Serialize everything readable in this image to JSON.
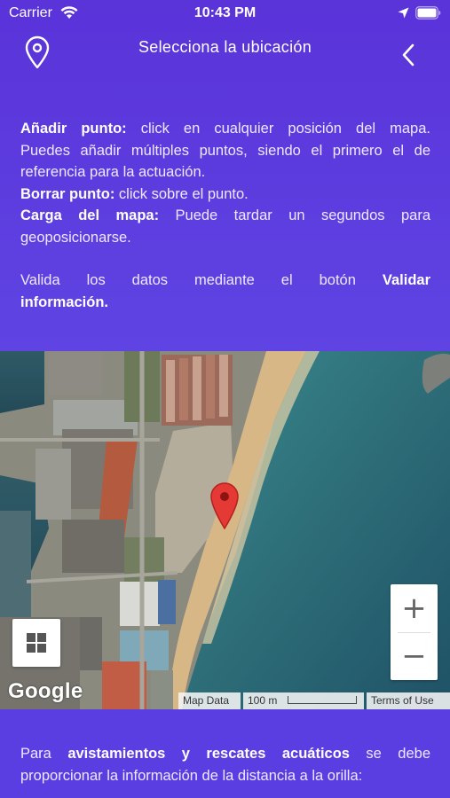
{
  "status_bar": {
    "carrier": "Carrier",
    "time": "10:43 PM",
    "icons": [
      "wifi-icon",
      "location-arrow-icon",
      "battery-icon"
    ]
  },
  "header": {
    "title": "Selecciona la ubicación",
    "left_icon": "map-pin-outline-icon",
    "right_icon": "chevron-left-icon"
  },
  "instructions": {
    "add_point_label": "Añadir punto:",
    "add_point_text_1": "click en cualquier posición del mapa.",
    "add_point_text_2": "Puedes añadir múltiples puntos, siendo el primero el de",
    "add_point_text_3": "referencia para la actuación.",
    "delete_point_label": "Borrar punto:",
    "delete_point_text": "click sobre el punto.",
    "map_load_label": "Carga del mapa:",
    "map_load_text_1": "Puede tardar un segundos para",
    "map_load_text_2": "geoposicionarse.",
    "validate_text": "Valida los datos mediante el botón",
    "validate_button_ref_1": "Validar",
    "validate_button_ref_2": "información.",
    "validate_line_words": [
      "Valida",
      "los",
      "datos",
      "mediante",
      "el",
      "botón"
    ]
  },
  "map": {
    "zoom_in_label": "+",
    "zoom_out_label": "−",
    "google_logo": "Google",
    "attribution_data": "Map Data",
    "scale_label": "100 m",
    "terms_label": "Terms of Use",
    "marker_color": "#e53935",
    "layers_icon": "grid-icon"
  },
  "footer_text": {
    "prefix": "Para",
    "emphasis": "avistamientos y rescates acuáticos",
    "suffix": "se debe",
    "line_2": "proporcionar la información de la distancia a la orilla:"
  },
  "colors": {
    "background": "#5b3ce0",
    "text": "#ffffff",
    "sea": "#2f6e78",
    "sand": "#d9b988"
  }
}
